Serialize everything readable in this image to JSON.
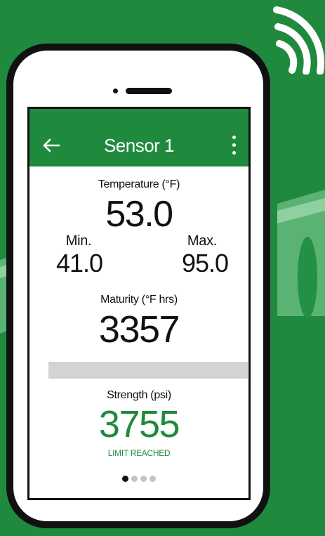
{
  "app_bar": {
    "title": "Sensor 1"
  },
  "temperature": {
    "label": "Temperature (°F)",
    "value": "53.0",
    "min_label": "Min.",
    "min_value": "41.0",
    "max_label": "Max.",
    "max_value": "95.0"
  },
  "maturity": {
    "label": "Maturity (°F hrs)",
    "value": "3357"
  },
  "progress": {
    "fraction": 0
  },
  "strength": {
    "label": "Strength (psi)",
    "value": "3755",
    "status": "LIMIT REACHED"
  },
  "pager": {
    "count": 4,
    "active_index": 0
  },
  "icons": {
    "back": "arrow-left-icon",
    "menu": "more-vertical-icon",
    "signal": "wifi-signal-icon"
  },
  "colors": {
    "brand_green": "#1f8a3e",
    "text_dark": "#111111",
    "track_gray": "#d3d3d3"
  }
}
